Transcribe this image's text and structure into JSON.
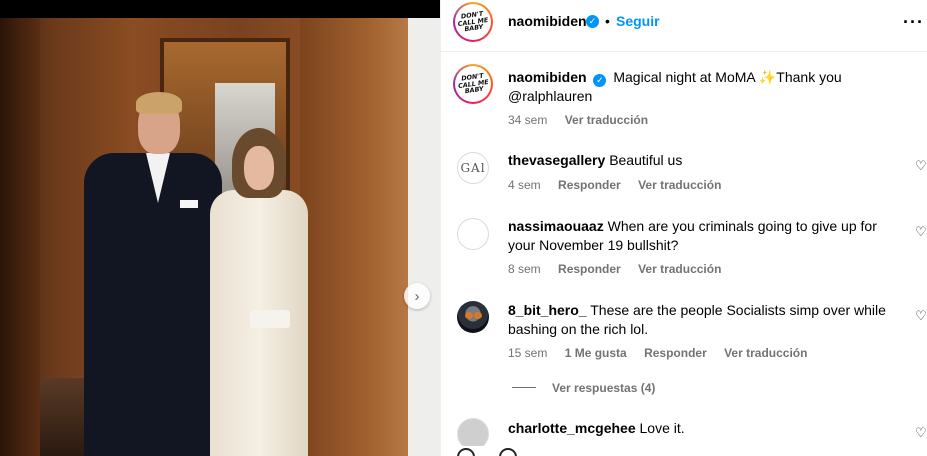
{
  "post": {
    "author": "naomibiden",
    "follow_label": "Seguir",
    "separator": "•",
    "more_label": "•••",
    "avatar_logo_text": "DON'T CALL ME BABY",
    "caption_text": "Magical night at MoMA ✨Thank you",
    "caption_mention": "@ralphlauren",
    "caption_time": "34 sem",
    "see_translation": "Ver traducción"
  },
  "comments": [
    {
      "user": "thevasegallery",
      "text": "Beautiful us",
      "time": "4 sem",
      "reply": "Responder",
      "translate": "Ver traducción",
      "avatar_text": "GAl"
    },
    {
      "user": "nassimaouaaz",
      "text": "When are you criminals going to give up for",
      "text_line2": "your November 19 bullshit?",
      "time": "8 sem",
      "reply": "Responder",
      "translate": "Ver traducción"
    },
    {
      "user": "8_bit_hero_",
      "text": "These are the people Socialists simp over while",
      "text_line2": "bashing on the rich lol.",
      "time": "15 sem",
      "likes": "1 Me gusta",
      "reply": "Responder",
      "translate": "Ver traducción",
      "view_replies": "Ver respuestas (4)"
    },
    {
      "user": "charlotte_mcgehee",
      "text": "Love it."
    }
  ],
  "icons": {
    "heart": "heart-icon",
    "verified": "verified-badge-icon",
    "next": "chevron-right-icon"
  },
  "colors": {
    "link_blue": "#0095f6",
    "muted_text": "#737373"
  }
}
